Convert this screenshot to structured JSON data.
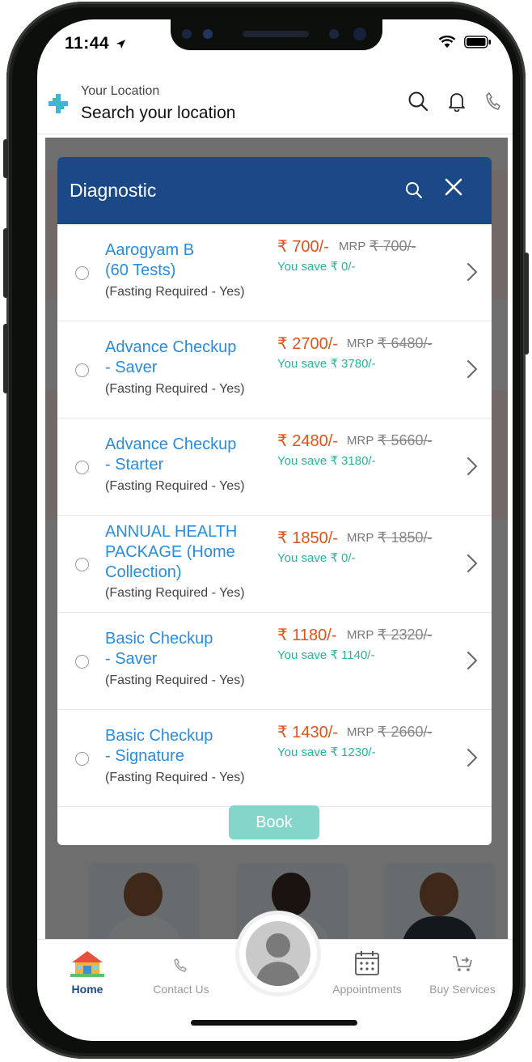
{
  "status_bar": {
    "time": "11:44"
  },
  "header": {
    "location_label": "Your Location",
    "location_value": "Search your location",
    "icons": [
      "search-icon",
      "bell-icon",
      "phone-icon"
    ]
  },
  "modal": {
    "title": "Diagnostic",
    "packages": [
      {
        "name": "Aarogyam B\n(60 Tests)",
        "fasting": "(Fasting Required - Yes)",
        "price": "₹ 700/-",
        "mrp_label": "MRP",
        "mrp": "₹ 700/-",
        "save": "You save ₹ 0/-"
      },
      {
        "name": "Advance Checkup\n- Saver",
        "fasting": "(Fasting Required - Yes)",
        "price": "₹ 2700/-",
        "mrp_label": "MRP",
        "mrp": "₹ 6480/-",
        "save": "You save ₹ 3780/-"
      },
      {
        "name": "Advance Checkup\n- Starter",
        "fasting": "(Fasting Required - Yes)",
        "price": "₹ 2480/-",
        "mrp_label": "MRP",
        "mrp": "₹ 5660/-",
        "save": "You save ₹ 3180/-"
      },
      {
        "name": "ANNUAL HEALTH\nPACKAGE (Home\nCollection)",
        "fasting": "(Fasting Required - Yes)",
        "price": "₹ 1850/-",
        "mrp_label": "MRP",
        "mrp": "₹ 1850/-",
        "save": "You save ₹ 0/-"
      },
      {
        "name": "Basic Checkup\n- Saver",
        "fasting": "(Fasting Required - Yes)",
        "price": "₹ 1180/-",
        "mrp_label": "MRP",
        "mrp": "₹ 2320/-",
        "save": "You save ₹ 1140/-"
      },
      {
        "name": "Basic Checkup\n- Signature",
        "fasting": "(Fasting Required - Yes)",
        "price": "₹ 1430/-",
        "mrp_label": "MRP",
        "mrp": "₹ 2660/-",
        "save": "You save ₹ 1230/-"
      }
    ],
    "book_label": "Book"
  },
  "tabbar": {
    "items": [
      {
        "label": "Home",
        "icon": "home-icon",
        "active": true
      },
      {
        "label": "Contact Us",
        "icon": "phone-icon",
        "active": false
      },
      {
        "label": "Appointments",
        "icon": "calendar-icon",
        "active": false
      },
      {
        "label": "Buy Services",
        "icon": "cart-icon",
        "active": false
      }
    ]
  },
  "colors": {
    "brand_blue": "#1b4886",
    "link_blue": "#2a8ce0",
    "price_orange": "#e0531a",
    "save_green": "#27b59a",
    "book_button": "#84d6cb"
  }
}
